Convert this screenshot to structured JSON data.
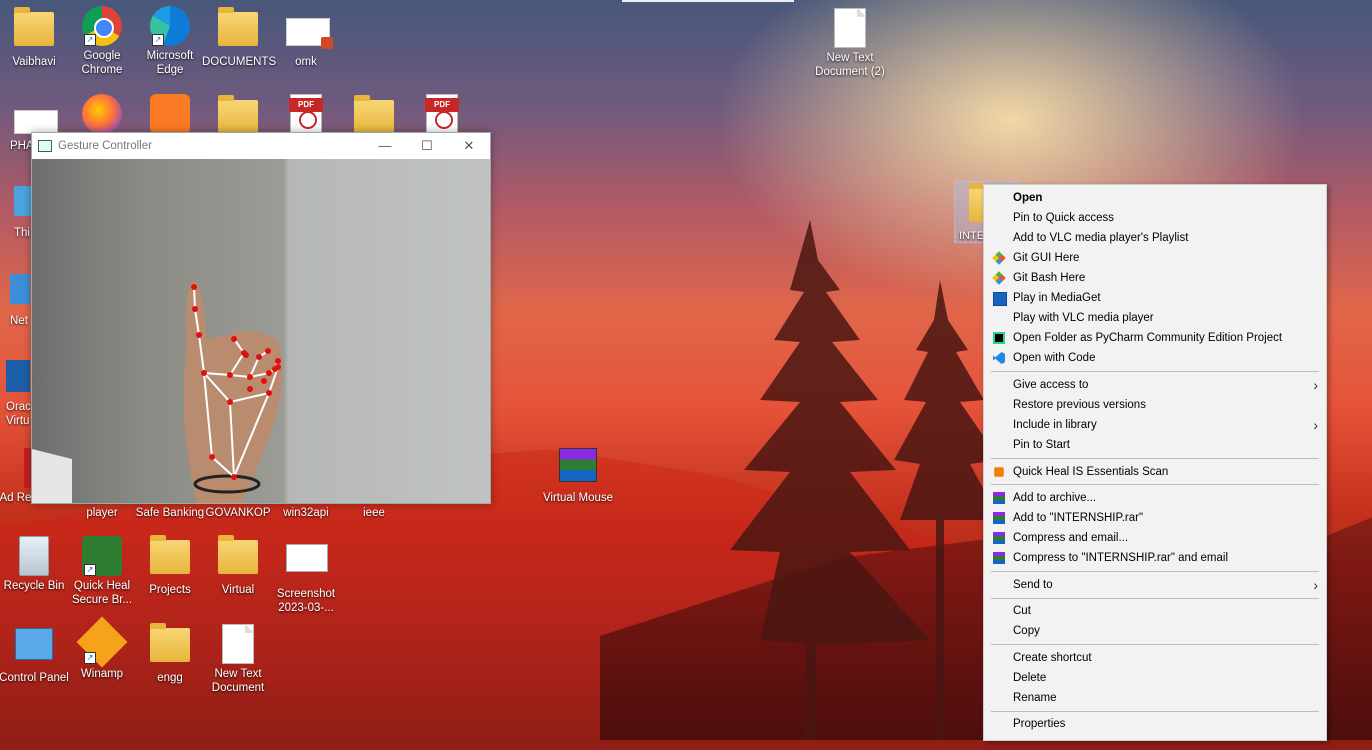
{
  "desktop_icons": {
    "vaibhavi": "Vaibhavi",
    "chrome": "Google Chrome",
    "edge": "Microsoft Edge",
    "documents": "DOCUMENTS",
    "omk": "omk",
    "new_text_doc2": "New Text Document (2)",
    "pha": "PHA",
    "thi": "Thi",
    "net": "Net",
    "oracle": "Orac Virtu",
    "adobe": "Ad Reader XI",
    "player": "player",
    "safe_banking": "Safe Banking",
    "govankop": "GOVANKOP",
    "win32api": "win32api",
    "ieee": "ieee",
    "virtual_mouse": "Virtual Mouse",
    "recycle_bin": "Recycle Bin",
    "quick_heal": "Quick Heal Secure Br...",
    "projects": "Projects",
    "virtual": "Virtual",
    "screenshot": "Screenshot 2023-03-...",
    "control_panel": "Control Panel",
    "winamp": "Winamp",
    "engg": "engg",
    "new_text_doc": "New Text Document",
    "internship": "INTE",
    "pdf_tag": "PDF"
  },
  "window": {
    "title": "Gesture Controller",
    "minimize": "—",
    "maximize": "☐",
    "close": "✕"
  },
  "context_menu": {
    "items": [
      {
        "label": "Open",
        "icon": ""
      },
      {
        "label": "Pin to Quick access",
        "icon": ""
      },
      {
        "label": "Add to VLC media player's Playlist",
        "icon": ""
      },
      {
        "label": "Git GUI Here",
        "icon": "git-icon"
      },
      {
        "label": "Git Bash Here",
        "icon": "git-icon"
      },
      {
        "label": "Play in MediaGet",
        "icon": "mediaget-icon"
      },
      {
        "label": "Play with VLC media player",
        "icon": ""
      },
      {
        "label": "Open Folder as PyCharm Community Edition Project",
        "icon": "pycharm-icon"
      },
      {
        "label": "Open with Code",
        "icon": "vscode-icon"
      },
      {
        "label": "Give access to",
        "icon": ""
      },
      {
        "label": "Restore previous versions",
        "icon": ""
      },
      {
        "label": "Include in library",
        "icon": ""
      },
      {
        "label": "Pin to Start",
        "icon": ""
      },
      {
        "label": "Quick Heal IS Essentials Scan",
        "icon": "quickheal-icon"
      },
      {
        "label": "Add to archive...",
        "icon": "winrar-icon"
      },
      {
        "label": "Add to \"INTERNSHIP.rar\"",
        "icon": "winrar-icon"
      },
      {
        "label": "Compress and email...",
        "icon": "winrar-icon"
      },
      {
        "label": "Compress to \"INTERNSHIP.rar\" and email",
        "icon": "winrar-icon"
      },
      {
        "label": "Send to",
        "icon": ""
      },
      {
        "label": "Cut",
        "icon": ""
      },
      {
        "label": "Copy",
        "icon": ""
      },
      {
        "label": "Create shortcut",
        "icon": ""
      },
      {
        "label": "Delete",
        "icon": ""
      },
      {
        "label": "Rename",
        "icon": ""
      },
      {
        "label": "Properties",
        "icon": ""
      }
    ],
    "submenu_arrow": "›"
  }
}
